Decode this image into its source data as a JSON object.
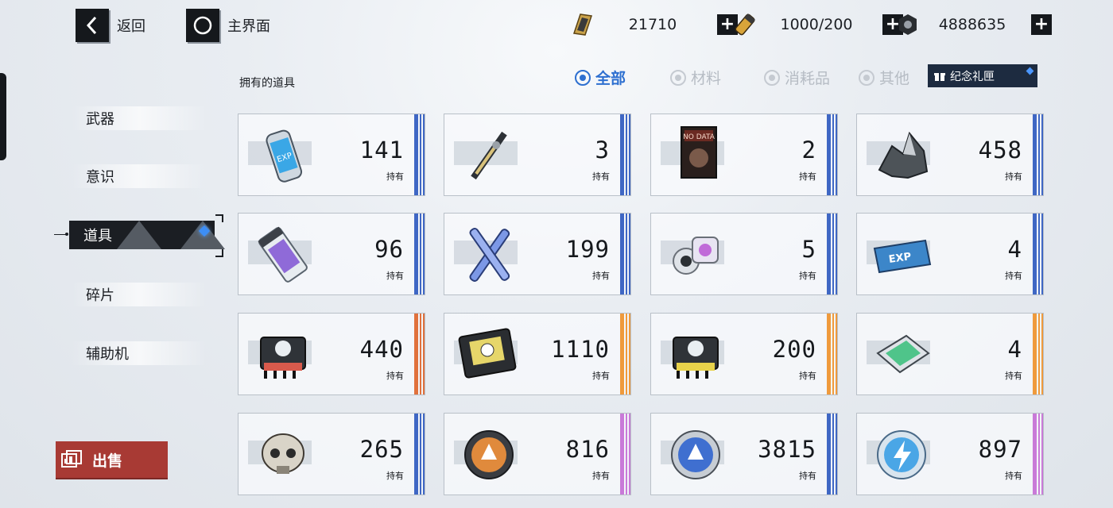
{
  "top": {
    "back_label": "返回",
    "home_label": "主界面",
    "resources": [
      {
        "icon": "gold-bar-icon",
        "value": "21710"
      },
      {
        "icon": "stamina-canister-icon",
        "value": "1000/200"
      },
      {
        "icon": "hex-nut-icon",
        "value": "4888635"
      }
    ]
  },
  "sidebar": {
    "items": [
      {
        "label": "武器"
      },
      {
        "label": "意识"
      },
      {
        "label": "道具"
      },
      {
        "label": "碎片"
      },
      {
        "label": "辅助机"
      }
    ],
    "active_index": 2
  },
  "main": {
    "section_title": "拥有的道具",
    "filters": [
      {
        "label": "全部",
        "selected": true
      },
      {
        "label": "材料",
        "selected": false
      },
      {
        "label": "消耗品",
        "selected": false
      },
      {
        "label": "其他",
        "selected": false
      }
    ],
    "gift_label": "纪念礼匣",
    "owned_label": "持有",
    "items": [
      {
        "icon": "exp-canister-icon",
        "count": "141",
        "rarity_color": "#3f67c4"
      },
      {
        "icon": "blade-key-icon",
        "count": "3",
        "rarity_color": "#3f67c4"
      },
      {
        "icon": "no-data-card-icon",
        "count": "2",
        "rarity_color": "#3f67c4"
      },
      {
        "icon": "ore-crystal-icon",
        "count": "458",
        "rarity_color": "#3f67c4"
      },
      {
        "icon": "exp-capsule-icon",
        "count": "96",
        "rarity_color": "#3f67c4"
      },
      {
        "icon": "crossed-tools-icon",
        "count": "199",
        "rarity_color": "#3f67c4"
      },
      {
        "icon": "core-cube-icon",
        "count": "5",
        "rarity_color": "#3f67c4"
      },
      {
        "icon": "exp-ticket-icon",
        "count": "4",
        "rarity_color": "#3f67c4"
      },
      {
        "icon": "red-chip-icon",
        "count": "440",
        "rarity_color": "#e0713c"
      },
      {
        "icon": "gold-chip-icon",
        "count": "1110",
        "rarity_color": "#ef9a3c"
      },
      {
        "icon": "yellow-chip-icon",
        "count": "200",
        "rarity_color": "#ef9a3c"
      },
      {
        "icon": "green-board-icon",
        "count": "4",
        "rarity_color": "#ef9a3c"
      },
      {
        "icon": "skull-helmet-icon",
        "count": "265",
        "rarity_color": "#3f67c4"
      },
      {
        "icon": "orange-medal-icon",
        "count": "816",
        "rarity_color": "#c97ad8"
      },
      {
        "icon": "blue-medal-icon",
        "count": "3815",
        "rarity_color": "#3f67c4"
      },
      {
        "icon": "lightning-medal-icon",
        "count": "897",
        "rarity_color": "#c97ad8"
      }
    ]
  },
  "sell_label": "出售"
}
